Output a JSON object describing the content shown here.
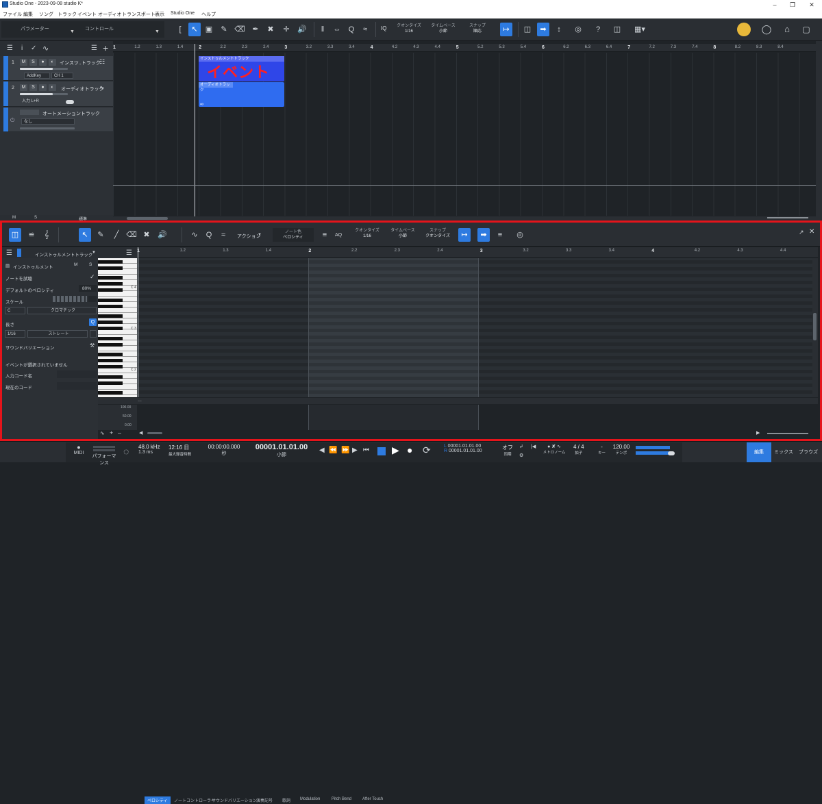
{
  "window": {
    "title": "Studio One - 2023-09-08 studio K*"
  },
  "menu": [
    "ファイル",
    "編集",
    "ソング",
    "トラック",
    "イベント",
    "オーディオ",
    "トランスポート",
    "表示",
    "Studio One",
    "ヘルプ"
  ],
  "toolbar": {
    "param_label": "パラメーター",
    "control_label": "コントロール",
    "iq": "IQ",
    "quantize_label": "クオンタイズ",
    "quantize_value": "1/16",
    "timebase_label": "タイムベース",
    "timebase_value": "小節",
    "snap_label": "スナップ",
    "snap_value": "順応",
    "help": "?"
  },
  "arrange": {
    "ruler": [
      "1",
      "1.2",
      "1.3",
      "1.4",
      "2",
      "2.2",
      "2.3",
      "2.4",
      "3",
      "3.2",
      "3.3",
      "3.4",
      "4",
      "4.2",
      "4.3",
      "4.4",
      "5",
      "5.2",
      "5.3",
      "5.4",
      "6",
      "6.2",
      "6.3",
      "6.4",
      "7",
      "7.2",
      "7.3",
      "7.4",
      "8",
      "8.2",
      "8.3",
      "8.4"
    ],
    "tracks": [
      {
        "num": "1",
        "m": "M",
        "s": "S",
        "name": "インスツ..トラック",
        "instrument": "AddKey",
        "channel": "CH 1"
      },
      {
        "num": "2",
        "m": "M",
        "s": "S",
        "name": "オーディオトラック",
        "input": "入力 L+R"
      },
      {
        "name": "オートメーショントラック",
        "value": "なし"
      }
    ],
    "events": [
      {
        "label": "インストゥルメントトラック",
        "overlay": "イベント"
      },
      {
        "label": "オーディオトラック"
      }
    ],
    "footer": {
      "m": "M",
      "s": "S",
      "std": "標準"
    }
  },
  "editor": {
    "toolbar": {
      "action": "アクション",
      "notecolor_label": "ノート色",
      "notecolor_value": "ベロシティ",
      "aq": "AQ",
      "quantize_label": "クオンタイズ",
      "quantize_value": "1/16",
      "timebase_label": "タイムベース",
      "timebase_value": "小節",
      "snap_label": "スナップ",
      "snap_value": "クオンタイズ"
    },
    "inspector": {
      "track": "インストゥルメントトラック",
      "instrument": "インストゥルメント",
      "m": "M",
      "s": "S",
      "note_test": "ノートを試聴",
      "default_velocity_label": "デフォルトのベロシティ",
      "default_velocity": "80%",
      "scale_label": "スケール",
      "scale_key": "C",
      "scale_type": "クロマチック",
      "length_label": "長さ",
      "length_value": "1/16",
      "length_mode": "ストレート",
      "sound_variation": "サウンドバリエーション",
      "no_event": "イベントが選択されていません",
      "input_chord": "入力コード名",
      "current_chord": "現在のコード"
    },
    "ruler": [
      "1",
      "1.2",
      "1.3",
      "1.4",
      "2",
      "2.2",
      "2.3",
      "2.4",
      "3",
      "3.2",
      "3.3",
      "3.4",
      "4",
      "4.2",
      "4.3",
      "4.4"
    ],
    "keys": [
      "C 4",
      "C 3",
      "C 2"
    ],
    "lane_tabs": [
      "ベロシティ",
      "ノートコントローラー",
      "サウンドバリエーション",
      "演奏記号",
      "歌詞",
      "Modulation",
      "Pitch Bend",
      "After Touch"
    ],
    "vel_scale": [
      "100.00",
      "50.00",
      "0.00"
    ]
  },
  "transport": {
    "midi": "MIDI",
    "perf": "パフォーマンス",
    "rate": "48.0 kHz",
    "latency": "1.3 ms",
    "rec_time": "12:16 日",
    "rec_label": "最大録音時間",
    "time": "00:00:00.000",
    "time_unit": "秒",
    "bars": "00001.01.01.00",
    "bars_unit": "小節",
    "L": "00001.01.01.00",
    "R": "00001.01.01.00",
    "sync": "オフ",
    "sync_label": "同期",
    "metronome": "メトロノーム",
    "sig": "4 / 4",
    "sig_label": "拍子",
    "key": "-",
    "key_label": "キー",
    "tempo": "120.00",
    "tempo_label": "テンポ"
  },
  "tabs": [
    "編集",
    "ミックス",
    "ブラウズ"
  ],
  "colors": {
    "accent": "#2e7be0",
    "highlight_border": "#e5141b",
    "event_blue": "#2f46e8",
    "audio_blue": "#2f6cf0"
  }
}
